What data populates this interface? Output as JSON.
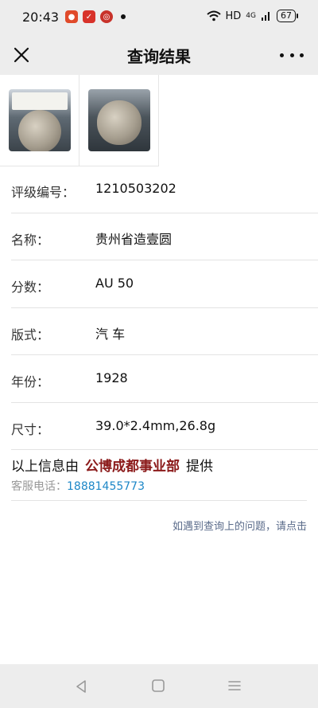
{
  "status_bar": {
    "time": "20:43",
    "network": "HD",
    "signal_label": "4G",
    "battery": "67"
  },
  "header": {
    "title": "查询结果"
  },
  "details": [
    {
      "label": "评级编号：",
      "value": "1210503202"
    },
    {
      "label": "名称：",
      "value": "贵州省造壹圆"
    },
    {
      "label": "分数：",
      "value": "AU 50"
    },
    {
      "label": "版式：",
      "value": "汽 车"
    },
    {
      "label": "年份：",
      "value": "1928"
    },
    {
      "label": "尺寸：",
      "value": "39.0*2.4mm,26.8g"
    }
  ],
  "provider": {
    "prefix": "以上信息由",
    "org": "公博成都事业部",
    "suffix": "提供"
  },
  "service": {
    "label": "客服电话：",
    "phone": "18881455773"
  },
  "help_link": "如遇到查询上的问题，请点击",
  "colors": {
    "bar_bg": "#ededed",
    "org_red": "#8b1a1a",
    "phone_blue": "#1d87c7",
    "link": "#5a6b8a"
  }
}
